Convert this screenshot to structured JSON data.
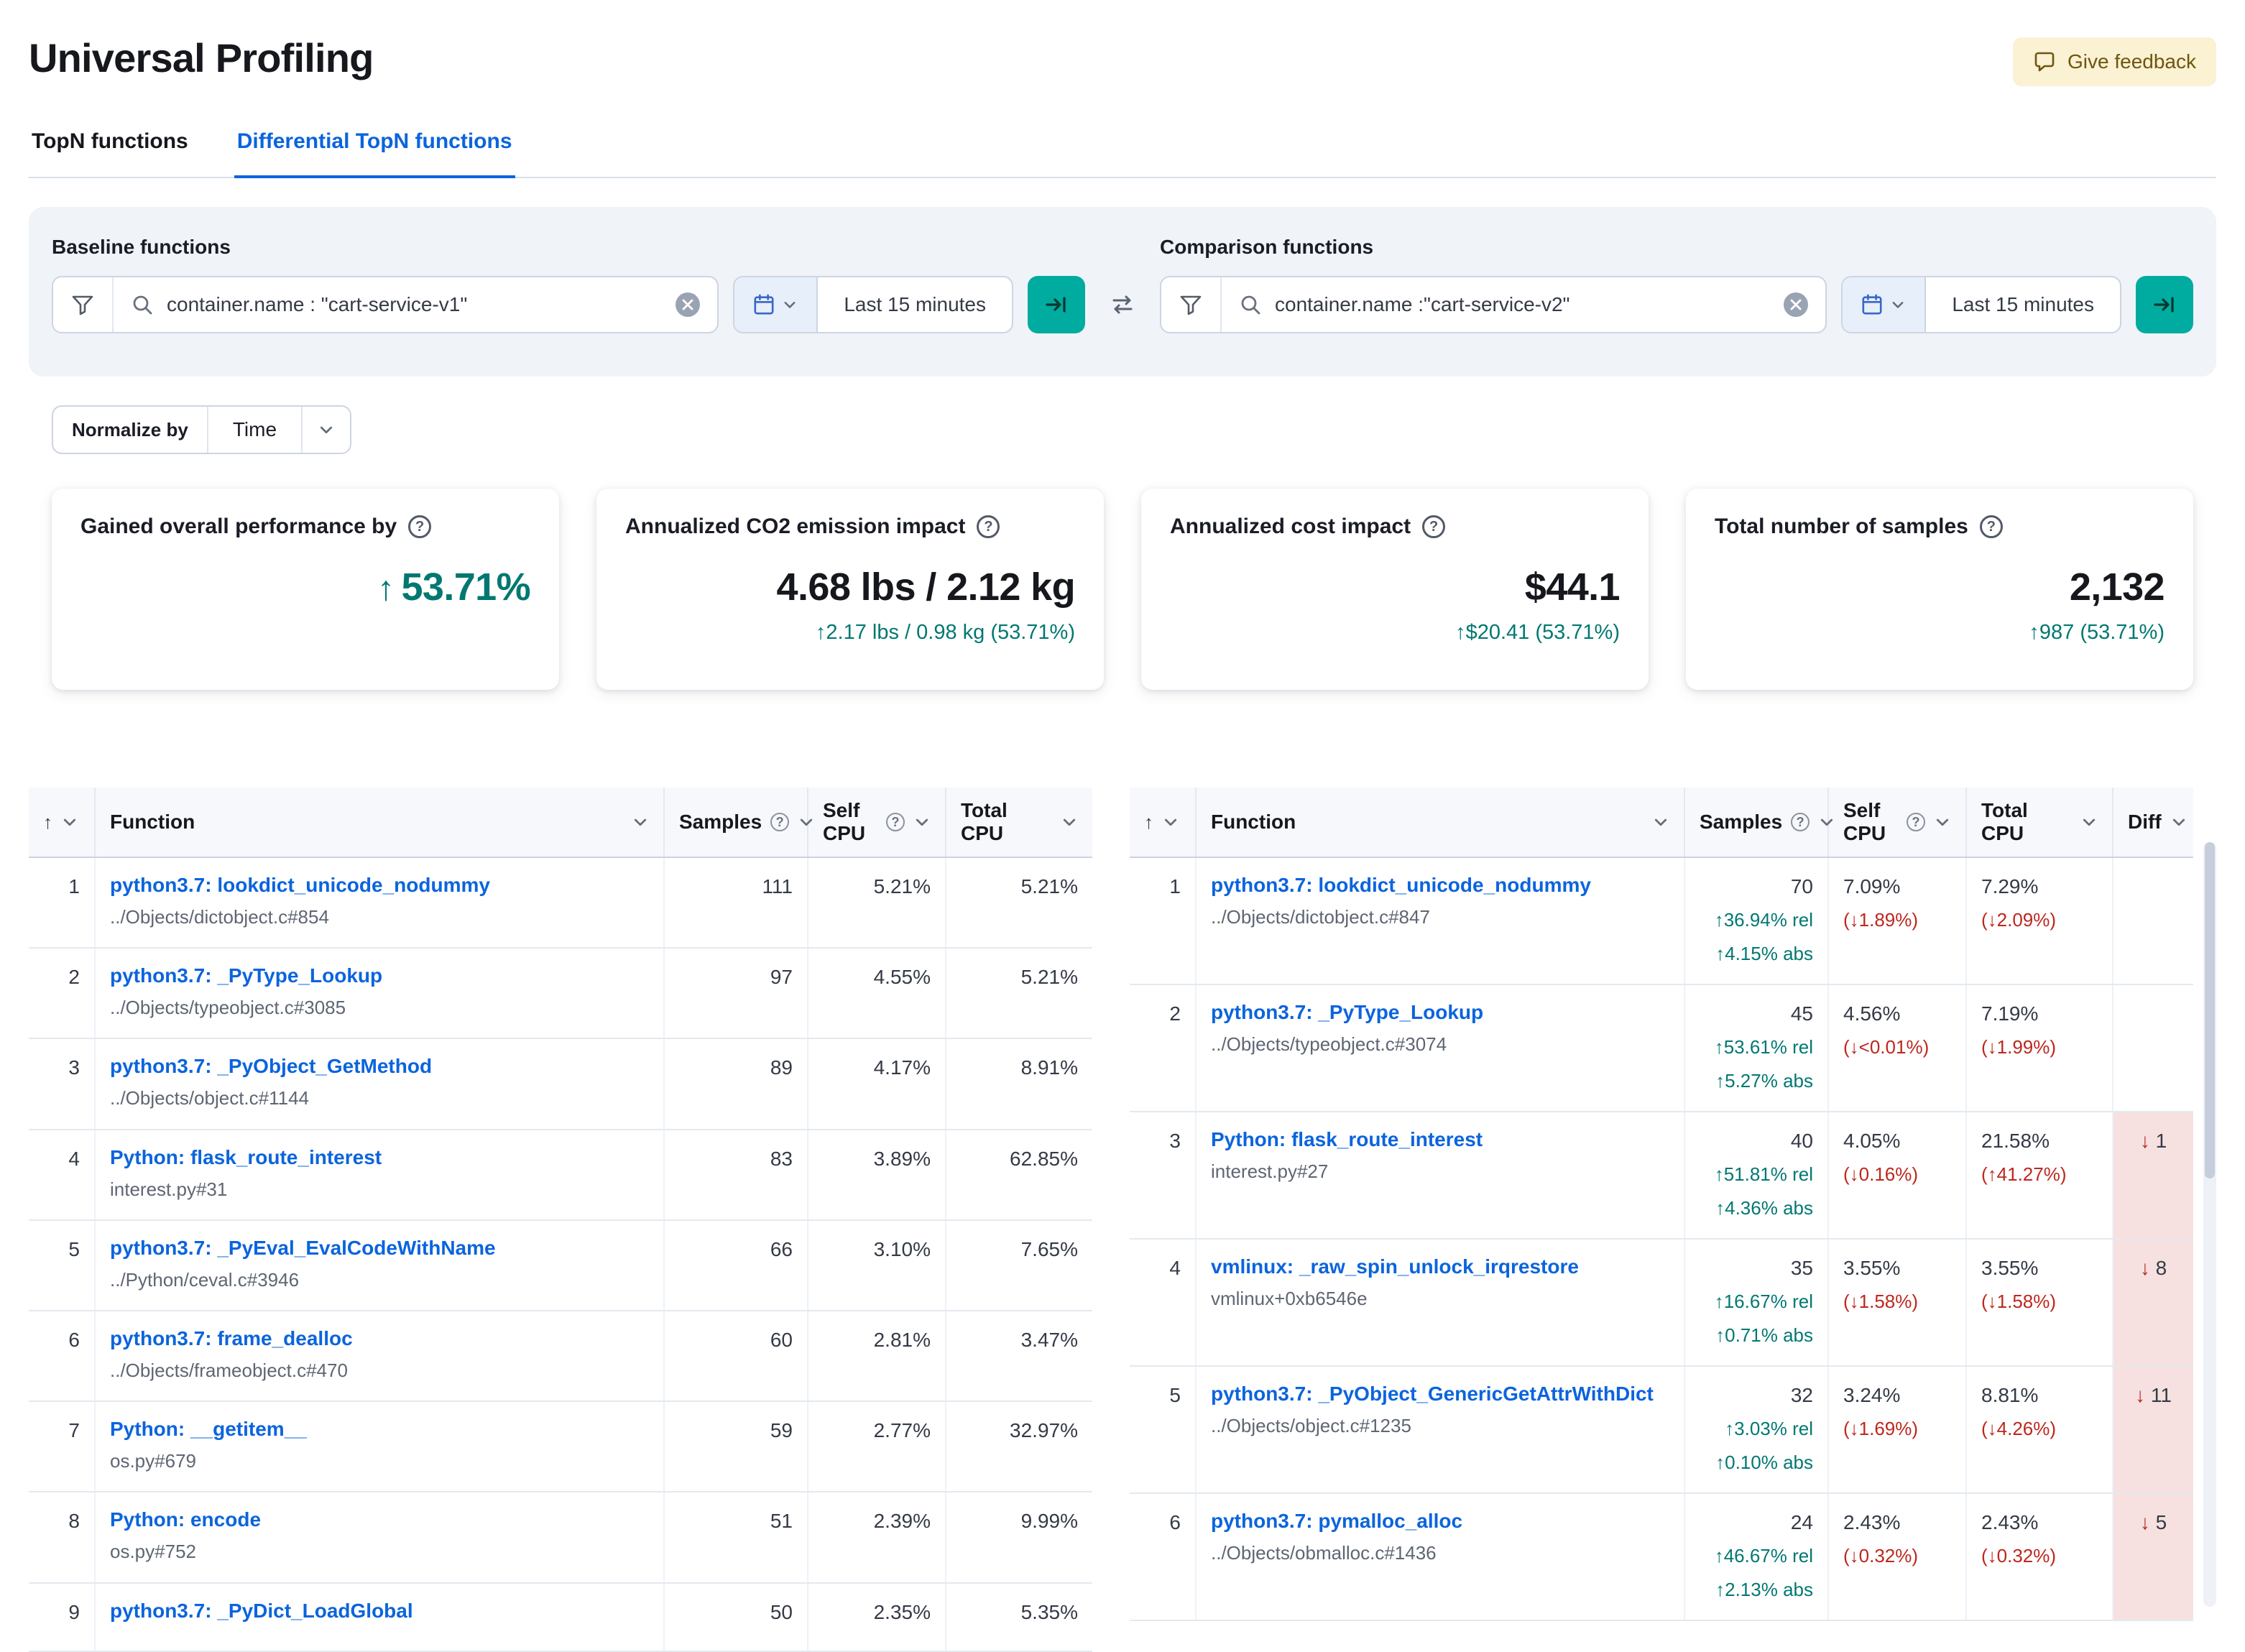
{
  "page": {
    "title": "Universal Profiling",
    "feedback_label": "Give feedback"
  },
  "tabs": [
    {
      "label": "TopN functions"
    },
    {
      "label": "Differential TopN functions"
    }
  ],
  "baseline": {
    "label": "Baseline functions",
    "query": "container.name : \"cart-service-v1\"",
    "time_range": "Last 15 minutes"
  },
  "comparison": {
    "label": "Comparison functions",
    "query": "container.name :\"cart-service-v2\"",
    "time_range": "Last 15 minutes"
  },
  "normalize": {
    "label": "Normalize by",
    "value": "Time"
  },
  "icons": {
    "question_mark": "?",
    "sort_ascending": "↑"
  },
  "colors": {
    "link_blue": "#0b64dd",
    "success_green": "#007871",
    "danger_red": "#bd271e",
    "accent_teal": "#00ac9f",
    "diff_pink": "#f6e1e0"
  },
  "summary_cards": [
    {
      "title": "Gained overall performance by",
      "arrow": "↑",
      "value": "53.71%"
    },
    {
      "title": "Annualized CO2 emission impact",
      "value": "4.68 lbs / 2.12 kg",
      "trend": "↑2.17 lbs / 0.98 kg (53.71%)"
    },
    {
      "title": "Annualized cost impact",
      "value": "$44.1",
      "trend": "↑$20.41 (53.71%)"
    },
    {
      "title": "Total number of samples",
      "value": "2,132",
      "trend": "↑987 (53.71%)"
    }
  ],
  "baseline_table": {
    "headers": {
      "function": "Function",
      "samples": "Samples",
      "self_cpu": "Self CPU",
      "total_cpu": "Total CPU"
    },
    "rows": [
      {
        "rank": "1",
        "function": "python3.7: lookdict_unicode_nodummy",
        "location": "../Objects/dictobject.c#854",
        "samples": "111",
        "self_cpu": "5.21%",
        "total_cpu": "5.21%"
      },
      {
        "rank": "2",
        "function": "python3.7: _PyType_Lookup",
        "location": "../Objects/typeobject.c#3085",
        "samples": "97",
        "self_cpu": "4.55%",
        "total_cpu": "5.21%"
      },
      {
        "rank": "3",
        "function": "python3.7: _PyObject_GetMethod",
        "location": "../Objects/object.c#1144",
        "samples": "89",
        "self_cpu": "4.17%",
        "total_cpu": "8.91%"
      },
      {
        "rank": "4",
        "function": "Python: flask_route_interest",
        "location": "interest.py#31",
        "samples": "83",
        "self_cpu": "3.89%",
        "total_cpu": "62.85%"
      },
      {
        "rank": "5",
        "function": "python3.7: _PyEval_EvalCodeWithName",
        "location": "../Python/ceval.c#3946",
        "samples": "66",
        "self_cpu": "3.10%",
        "total_cpu": "7.65%"
      },
      {
        "rank": "6",
        "function": "python3.7: frame_dealloc",
        "location": "../Objects/frameobject.c#470",
        "samples": "60",
        "self_cpu": "2.81%",
        "total_cpu": "3.47%"
      },
      {
        "rank": "7",
        "function": "Python: __getitem__",
        "location": "os.py#679",
        "samples": "59",
        "self_cpu": "2.77%",
        "total_cpu": "32.97%"
      },
      {
        "rank": "8",
        "function": "Python: encode",
        "location": "os.py#752",
        "samples": "51",
        "self_cpu": "2.39%",
        "total_cpu": "9.99%"
      },
      {
        "rank": "9",
        "function": "python3.7: _PyDict_LoadGlobal",
        "location": "",
        "samples": "50",
        "self_cpu": "2.35%",
        "total_cpu": "5.35%"
      }
    ]
  },
  "comparison_table": {
    "headers": {
      "function": "Function",
      "samples": "Samples",
      "self_cpu": "Self CPU",
      "total_cpu": "Total CPU",
      "diff": "Diff"
    },
    "rows": [
      {
        "rank": "1",
        "function": "python3.7: lookdict_unicode_nodummy",
        "location": "../Objects/dictobject.c#847",
        "samples": "70",
        "samples_rel": "↑36.94% rel",
        "samples_abs": "↑4.15% abs",
        "self_cpu": "7.09%",
        "self_cpu_diff": "(↓1.89%)",
        "total_cpu": "7.29%",
        "total_cpu_diff": "(↓2.09%)",
        "diff": null
      },
      {
        "rank": "2",
        "function": "python3.7: _PyType_Lookup",
        "location": "../Objects/typeobject.c#3074",
        "samples": "45",
        "samples_rel": "↑53.61% rel",
        "samples_abs": "↑5.27% abs",
        "self_cpu": "4.56%",
        "self_cpu_diff": "(↓<0.01%)",
        "total_cpu": "7.19%",
        "total_cpu_diff": "(↓1.99%)",
        "diff": null
      },
      {
        "rank": "3",
        "function": "Python: flask_route_interest",
        "location": "interest.py#27",
        "samples": "40",
        "samples_rel": "↑51.81% rel",
        "samples_abs": "↑4.36% abs",
        "self_cpu": "4.05%",
        "self_cpu_diff": "(↓0.16%)",
        "total_cpu": "21.58%",
        "total_cpu_diff": "(↑41.27%)",
        "diff": {
          "arrow": "↓",
          "value": "1"
        }
      },
      {
        "rank": "4",
        "function": "vmlinux: _raw_spin_unlock_irqrestore",
        "location": "vmlinux+0xb6546e",
        "samples": "35",
        "samples_rel": "↑16.67% rel",
        "samples_abs": "↑0.71% abs",
        "self_cpu": "3.55%",
        "self_cpu_diff": "(↓1.58%)",
        "total_cpu": "3.55%",
        "total_cpu_diff": "(↓1.58%)",
        "diff": {
          "arrow": "↓",
          "value": "8"
        }
      },
      {
        "rank": "5",
        "function": "python3.7: _PyObject_GenericGetAttrWithDict",
        "location": "../Objects/object.c#1235",
        "samples": "32",
        "samples_rel": "↑3.03% rel",
        "samples_abs": "↑0.10% abs",
        "self_cpu": "3.24%",
        "self_cpu_diff": "(↓1.69%)",
        "total_cpu": "8.81%",
        "total_cpu_diff": "(↓4.26%)",
        "diff": {
          "arrow": "↓",
          "value": "11"
        }
      },
      {
        "rank": "6",
        "function": "python3.7: pymalloc_alloc",
        "location": "../Objects/obmalloc.c#1436",
        "samples": "24",
        "samples_rel": "↑46.67% rel",
        "samples_abs": "↑2.13% abs",
        "self_cpu": "2.43%",
        "self_cpu_diff": "(↓0.32%)",
        "total_cpu": "2.43%",
        "total_cpu_diff": "(↓0.32%)",
        "diff": {
          "arrow": "↓",
          "value": "5"
        }
      }
    ]
  }
}
